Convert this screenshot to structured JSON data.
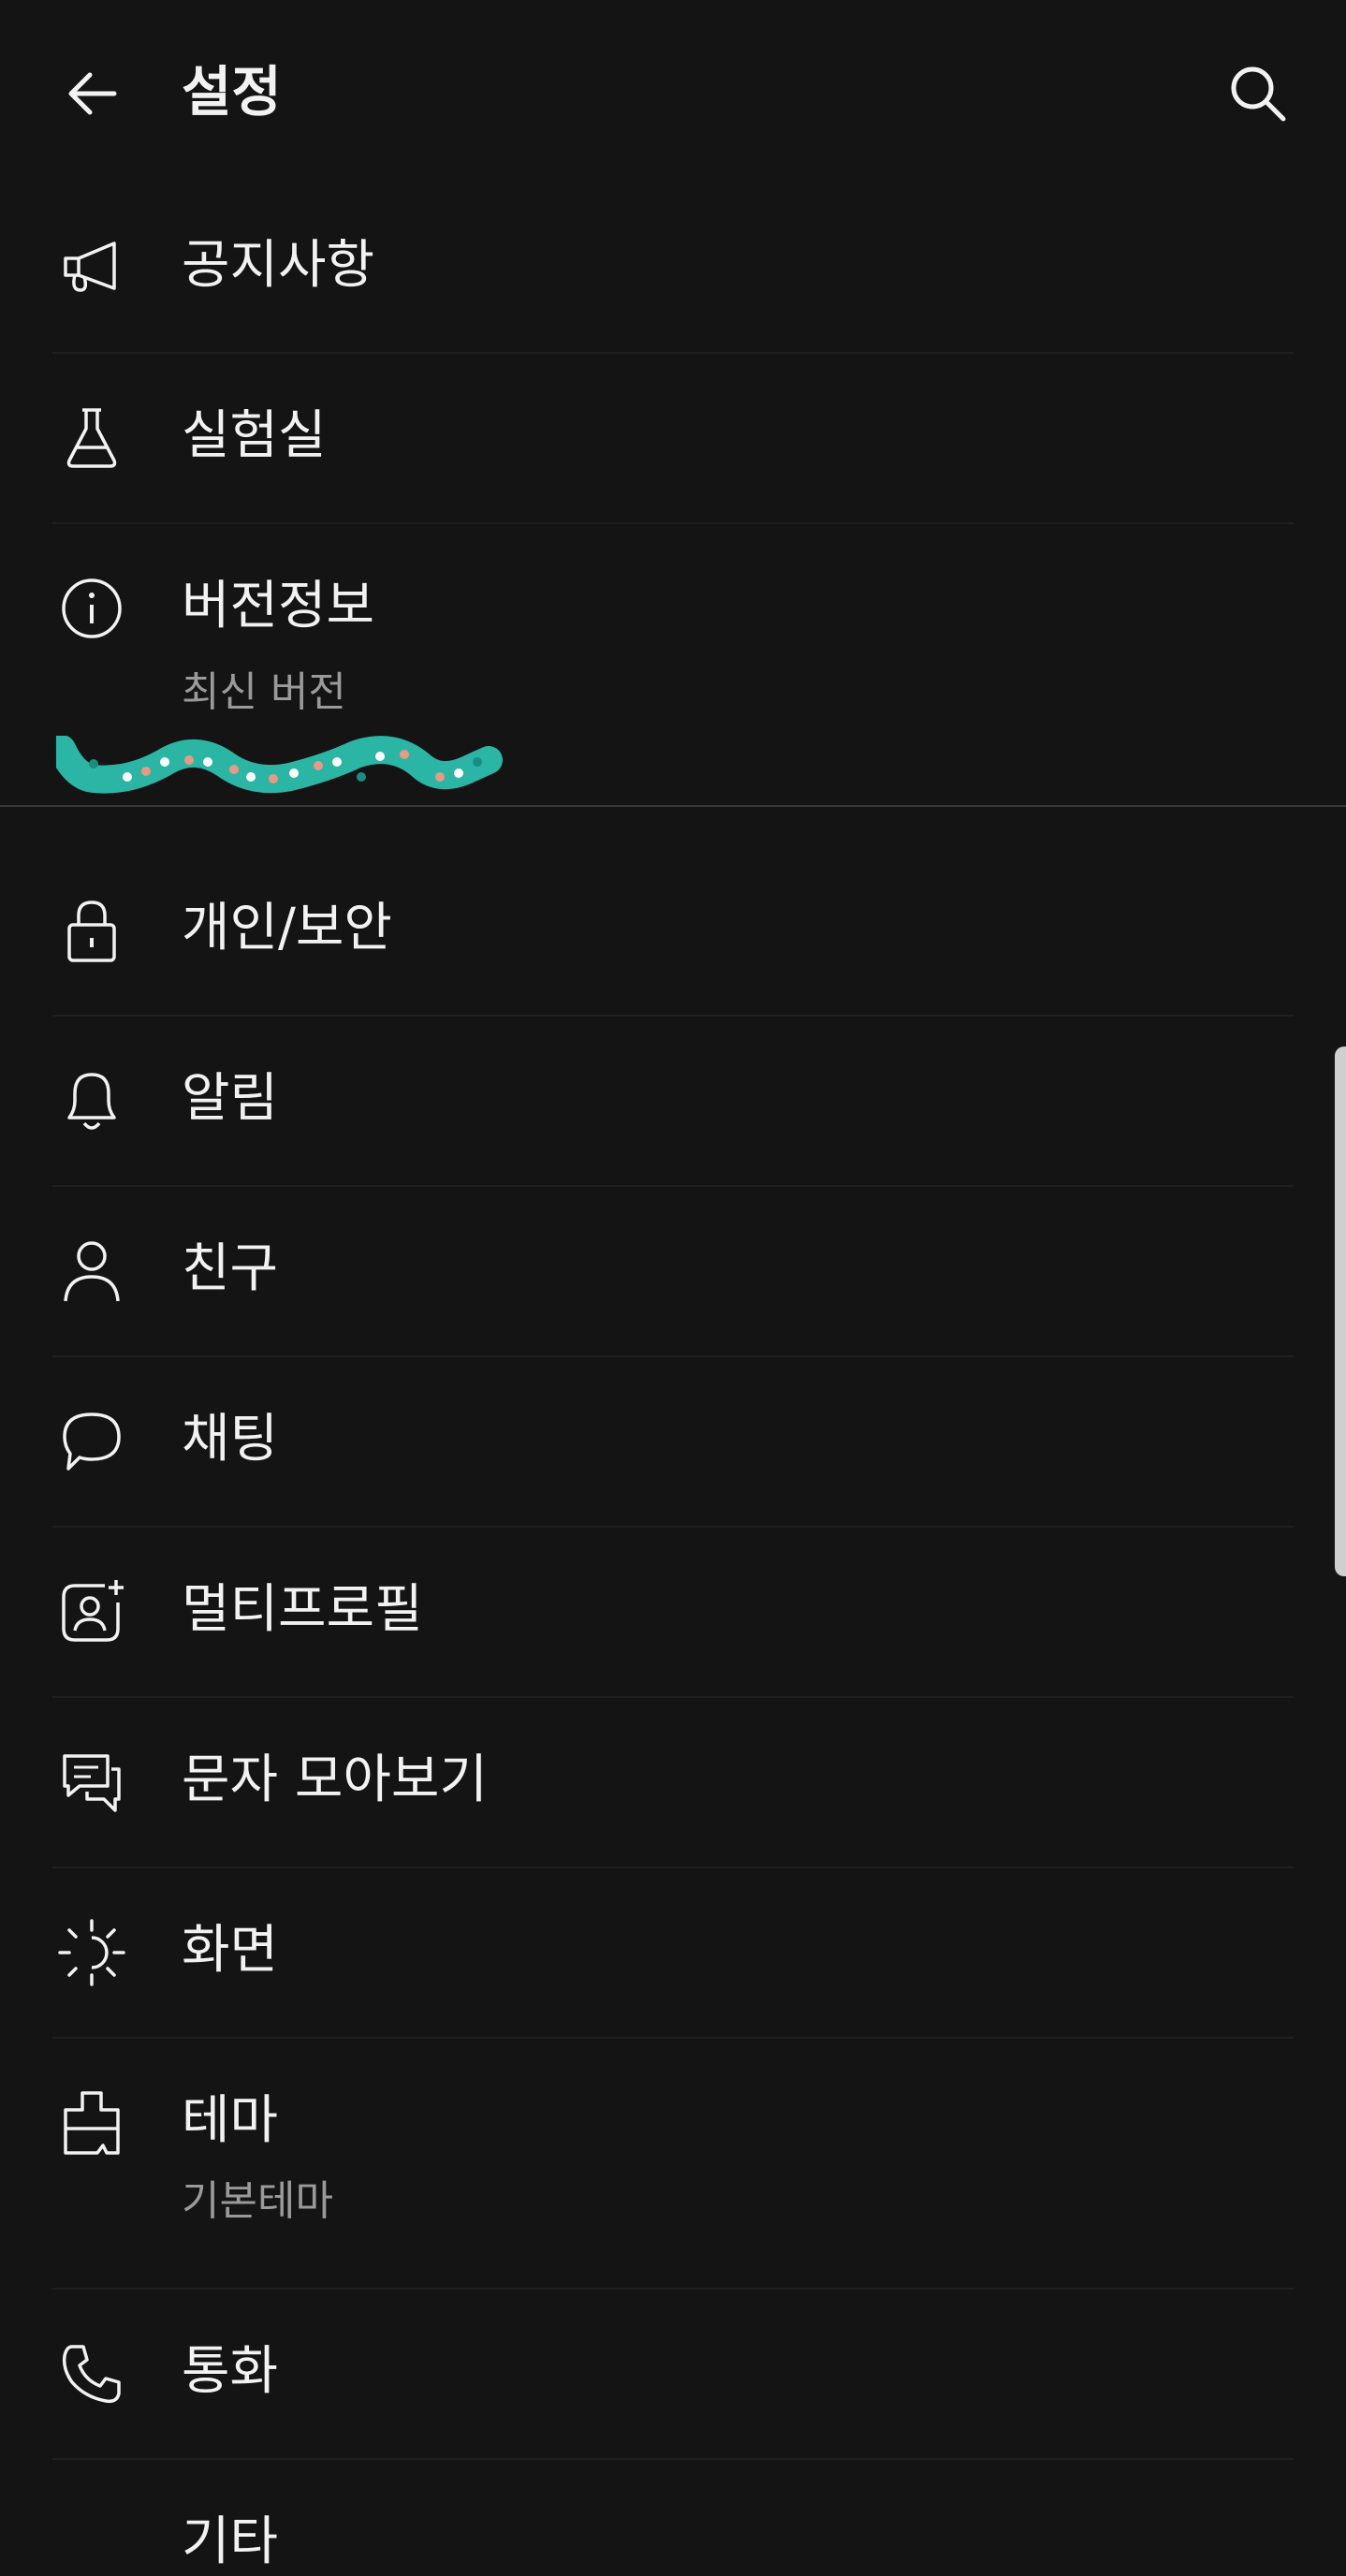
{
  "header": {
    "title": "설정",
    "back_icon": "arrow-left-icon",
    "search_icon": "search-icon"
  },
  "items": [
    {
      "label": "공지사항",
      "icon": "megaphone-icon"
    },
    {
      "label": "실험실",
      "icon": "flask-icon"
    },
    {
      "label": "버전정보",
      "sub": "최신 버전",
      "icon": "info-icon"
    },
    {
      "label": "개인/보안",
      "icon": "lock-icon"
    },
    {
      "label": "알림",
      "icon": "bell-icon"
    },
    {
      "label": "친구",
      "icon": "person-icon"
    },
    {
      "label": "채팅",
      "icon": "chat-bubble-icon"
    },
    {
      "label": "멀티프로필",
      "icon": "multi-profile-icon"
    },
    {
      "label": "문자 모아보기",
      "icon": "message-icon"
    },
    {
      "label": "화면",
      "icon": "brightness-icon"
    },
    {
      "label": "테마",
      "sub": "기본테마",
      "icon": "theme-brush-icon"
    },
    {
      "label": "통화",
      "icon": "phone-icon"
    },
    {
      "label": "기타"
    }
  ],
  "colors": {
    "background": "#141414",
    "text": "#f2f2f2",
    "subtext": "#9a9a9a",
    "decoration_teal": "#2bb5a5"
  }
}
